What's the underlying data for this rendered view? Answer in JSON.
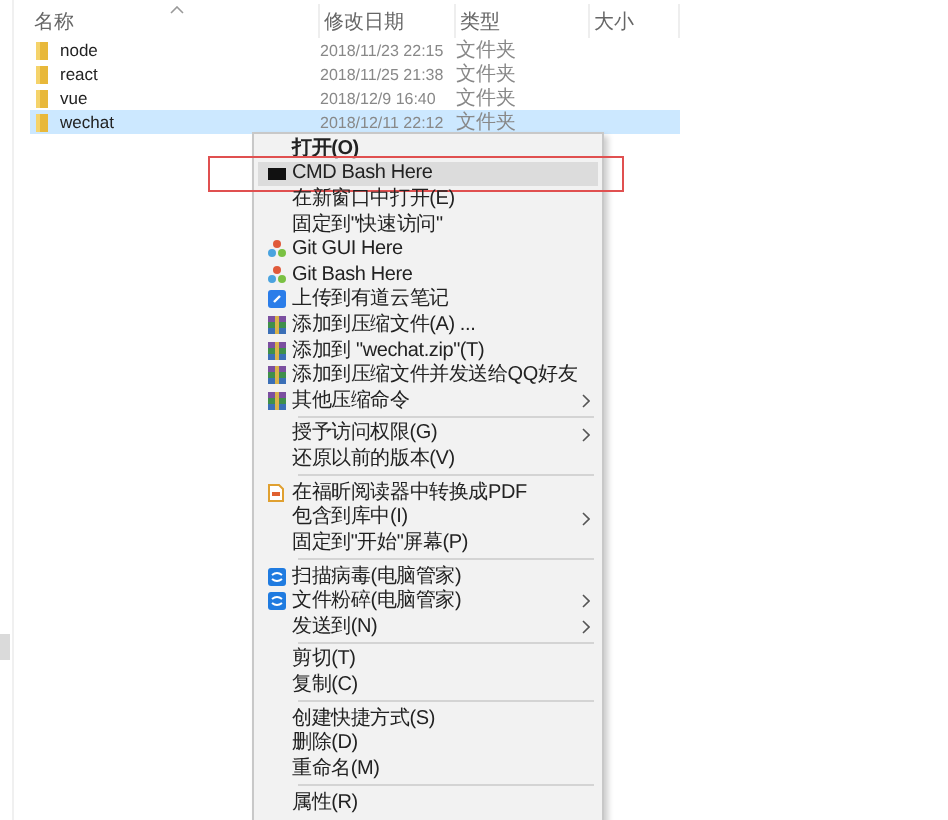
{
  "columns": [
    {
      "label": "名称",
      "sorted": true
    },
    {
      "label": "修改日期"
    },
    {
      "label": "类型"
    },
    {
      "label": "大小"
    }
  ],
  "rows": [
    {
      "name": "node",
      "modified": "2018/11/23 22:15",
      "type": "文件夹",
      "selected": false
    },
    {
      "name": "react",
      "modified": "2018/11/25 21:38",
      "type": "文件夹",
      "selected": false
    },
    {
      "name": "vue",
      "modified": "2018/12/9 16:40",
      "type": "文件夹",
      "selected": false
    },
    {
      "name": "wechat",
      "modified": "2018/12/11 22:12",
      "type": "文件夹",
      "selected": true
    }
  ],
  "context_menu": {
    "items": [
      {
        "kind": "plain",
        "label": "打开(O)",
        "bold": true,
        "selected": false,
        "framed": false
      },
      {
        "kind": "console",
        "label": "CMD Bash Here",
        "selected": true,
        "framed": true
      },
      {
        "kind": "plain",
        "label": "在新窗口中打开(E)",
        "selected": false,
        "framed": false
      },
      {
        "kind": "plain",
        "label": "固定到\"快速访问\"",
        "selected": false,
        "framed": false
      },
      {
        "kind": "git",
        "label": "Git GUI Here",
        "selected": false,
        "framed": false
      },
      {
        "kind": "git",
        "label": "Git Bash Here",
        "selected": false,
        "framed": false
      },
      {
        "kind": "note",
        "label": "上传到有道云笔记",
        "selected": false,
        "framed": false
      },
      {
        "kind": "archive",
        "label": "添加到压缩文件(A) ...",
        "selected": false,
        "framed": false
      },
      {
        "kind": "archive",
        "label": "添加到 \"wechat.zip\"(T)",
        "selected": false,
        "framed": false
      },
      {
        "kind": "archive",
        "label": "添加到压缩文件并发送给QQ好友",
        "selected": false,
        "framed": false
      },
      {
        "kind": "archive",
        "label": "其他压缩命令",
        "submenu": true,
        "selected": false,
        "framed": false
      },
      {
        "kind": "separator"
      },
      {
        "kind": "plain",
        "label": "授予访问权限(G)",
        "submenu": true,
        "selected": false,
        "framed": false
      },
      {
        "kind": "plain",
        "label": "还原以前的版本(V)",
        "selected": false,
        "framed": false
      },
      {
        "kind": "separator"
      },
      {
        "kind": "pdf",
        "label": "在福昕阅读器中转换成PDF",
        "selected": false,
        "framed": false
      },
      {
        "kind": "plain",
        "label": "包含到库中(I)",
        "submenu": true,
        "selected": false,
        "framed": false
      },
      {
        "kind": "plain",
        "label": "固定到\"开始\"屏幕(P)",
        "selected": false,
        "framed": false
      },
      {
        "kind": "separator"
      },
      {
        "kind": "shield",
        "label": "扫描病毒(电脑管家)",
        "selected": false,
        "framed": false
      },
      {
        "kind": "shield",
        "label": "文件粉碎(电脑管家)",
        "submenu": true,
        "selected": false,
        "framed": false
      },
      {
        "kind": "plain",
        "label": "发送到(N)",
        "submenu": true,
        "selected": false,
        "framed": false
      },
      {
        "kind": "separator"
      },
      {
        "kind": "plain",
        "label": "剪切(T)",
        "selected": false,
        "framed": false
      },
      {
        "kind": "plain",
        "label": "复制(C)",
        "selected": false,
        "framed": false
      },
      {
        "kind": "separator"
      },
      {
        "kind": "plain",
        "label": "创建快捷方式(S)",
        "selected": false,
        "framed": false
      },
      {
        "kind": "plain",
        "label": "删除(D)",
        "selected": false,
        "framed": false
      },
      {
        "kind": "plain",
        "label": "重命名(M)",
        "selected": false,
        "framed": false
      },
      {
        "kind": "separator"
      },
      {
        "kind": "plain",
        "label": "属性(R)",
        "selected": false,
        "framed": false
      }
    ]
  }
}
